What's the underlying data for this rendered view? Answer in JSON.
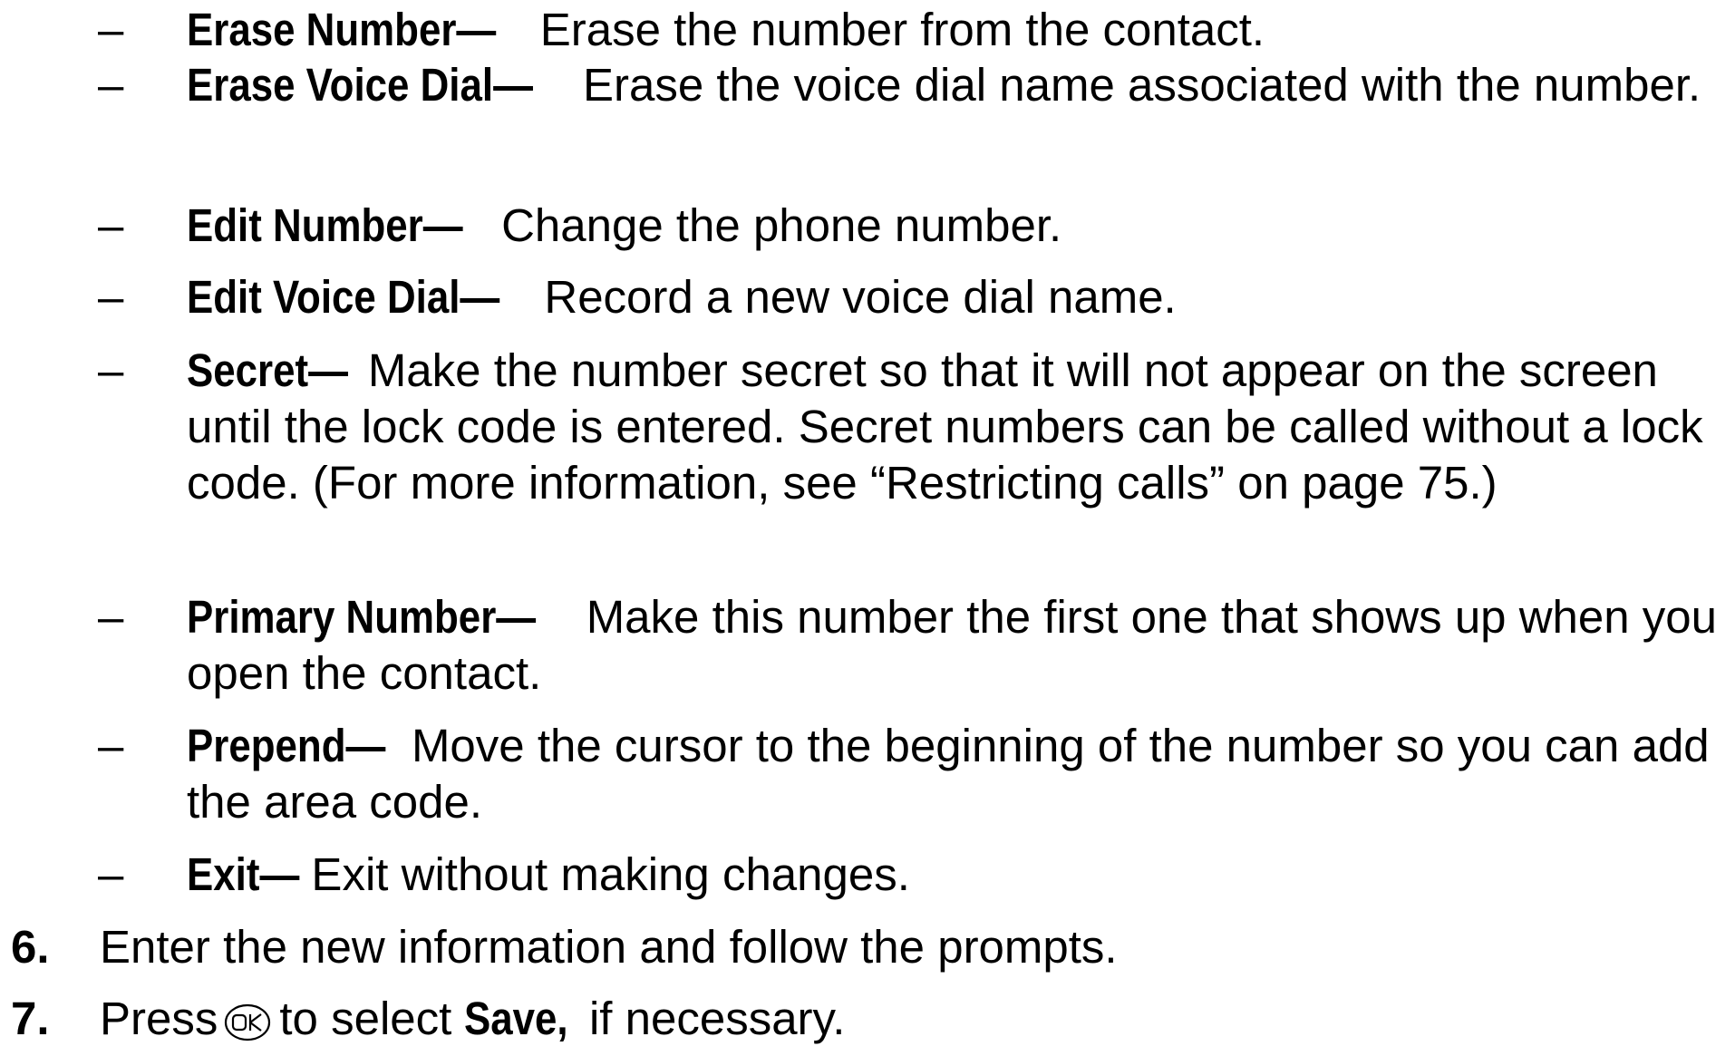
{
  "bullets": [
    {
      "term": "Erase Number—",
      "text": "Erase the number from the contact."
    },
    {
      "term": "Erase Voice Dial—",
      "text": "Erase the voice dial name associated with the number."
    },
    {
      "term": "Edit Number—",
      "text": "Change the phone number."
    },
    {
      "term": "Edit Voice Dial—",
      "text": "Record a new voice dial name."
    },
    {
      "term": "Secret—",
      "text": "Make the number secret so that it will not appear on the screen until the lock code is entered. Secret numbers can be called without a lock code. (For more information, see “Restricting calls” on page 75.)"
    },
    {
      "term": "Primary Number—",
      "text": "Make this number the first one that shows up when you open the contact."
    },
    {
      "term": "Prepend—",
      "text": "Move the cursor to the beginning of the number so you can add the area code."
    },
    {
      "term": "Exit—",
      "text": "Exit without making changes."
    }
  ],
  "bullet_marker": "–",
  "steps": [
    {
      "number": "6.",
      "text": "Enter the new information and follow the prompts."
    },
    {
      "number": "7.",
      "text_before": "Press",
      "icon": "ok-key-icon",
      "text_middle": "to select",
      "bold": "Save,",
      "text_after": "if necessary."
    }
  ]
}
